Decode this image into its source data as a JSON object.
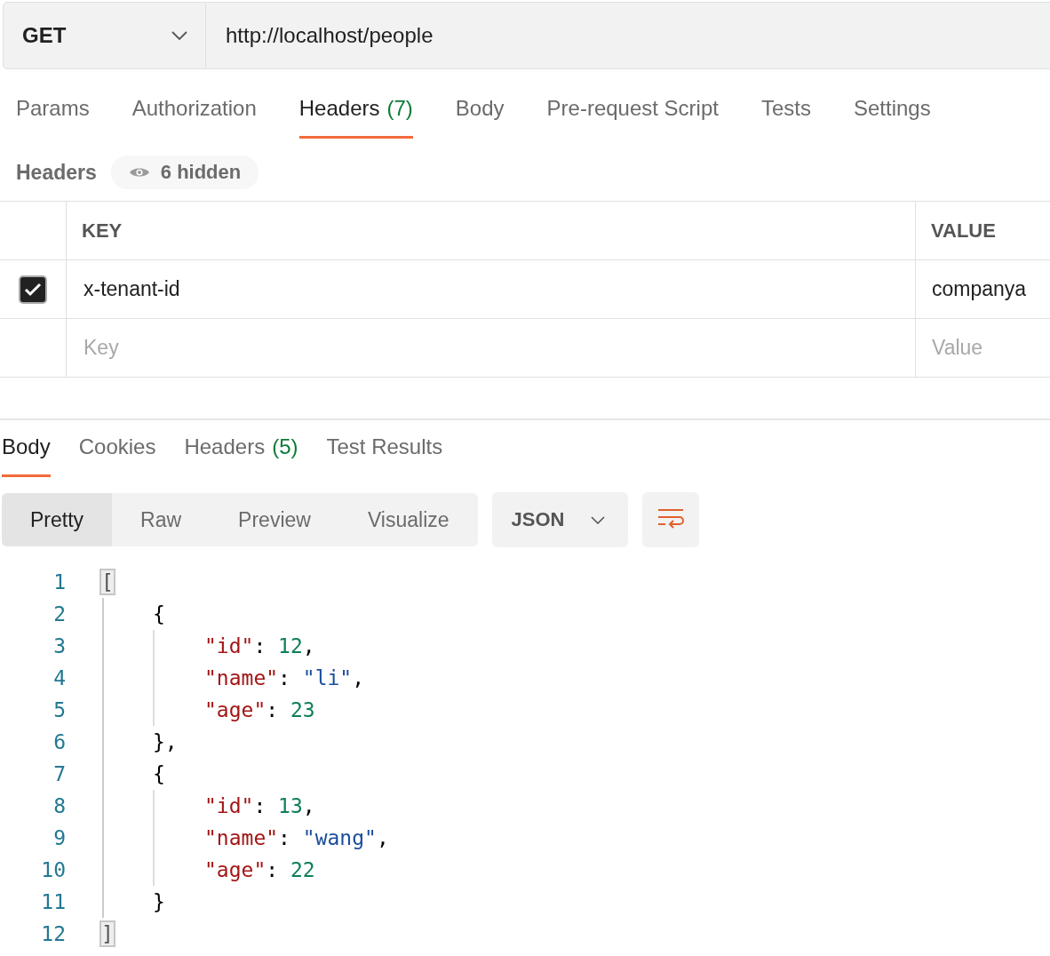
{
  "request": {
    "method": "GET",
    "url": "http://localhost/people"
  },
  "request_tabs": [
    {
      "label": "Params",
      "selected": false
    },
    {
      "label": "Authorization",
      "selected": false
    },
    {
      "label": "Headers",
      "count": "(7)",
      "selected": true
    },
    {
      "label": "Body",
      "selected": false
    },
    {
      "label": "Pre-request Script",
      "selected": false
    },
    {
      "label": "Tests",
      "selected": false
    },
    {
      "label": "Settings",
      "selected": false
    }
  ],
  "headers": {
    "title": "Headers",
    "hidden_badge": "6 hidden",
    "columns": [
      "KEY",
      "VALUE"
    ],
    "rows": [
      {
        "checked": true,
        "key": "x-tenant-id",
        "value": "companya"
      }
    ],
    "new_row": {
      "key_placeholder": "Key",
      "value_placeholder": "Value"
    }
  },
  "response_tabs": [
    {
      "label": "Body",
      "selected": true
    },
    {
      "label": "Cookies",
      "selected": false
    },
    {
      "label": "Headers",
      "count": "(5)",
      "selected": false
    },
    {
      "label": "Test Results",
      "selected": false
    }
  ],
  "view_modes": [
    {
      "label": "Pretty",
      "selected": true
    },
    {
      "label": "Raw",
      "selected": false
    },
    {
      "label": "Preview",
      "selected": false
    },
    {
      "label": "Visualize",
      "selected": false
    }
  ],
  "format": "JSON",
  "code": {
    "line_numbers": [
      "1",
      "2",
      "3",
      "4",
      "5",
      "6",
      "7",
      "8",
      "9",
      "10",
      "11",
      "12"
    ],
    "blocks": [
      {
        "open": [
          {
            "kind": "bracket_match",
            "text": "["
          }
        ],
        "close": [
          {
            "kind": "bracket_match",
            "text": "]"
          }
        ],
        "children": [
          {
            "open": [
              {
                "kind": "punct",
                "text": "{"
              }
            ],
            "close": [
              {
                "kind": "punct",
                "text": "},"
              }
            ],
            "children": [
              {
                "tokens": [
                  {
                    "kind": "key",
                    "text": "\"id\""
                  },
                  {
                    "kind": "punct",
                    "text": ": "
                  },
                  {
                    "kind": "number",
                    "text": "12"
                  },
                  {
                    "kind": "punct",
                    "text": ","
                  }
                ]
              },
              {
                "tokens": [
                  {
                    "kind": "key",
                    "text": "\"name\""
                  },
                  {
                    "kind": "punct",
                    "text": ": "
                  },
                  {
                    "kind": "string",
                    "text": "\"li\""
                  },
                  {
                    "kind": "punct",
                    "text": ","
                  }
                ]
              },
              {
                "tokens": [
                  {
                    "kind": "key",
                    "text": "\"age\""
                  },
                  {
                    "kind": "punct",
                    "text": ": "
                  },
                  {
                    "kind": "number",
                    "text": "23"
                  }
                ]
              }
            ]
          },
          {
            "open": [
              {
                "kind": "punct",
                "text": "{"
              }
            ],
            "close": [
              {
                "kind": "punct",
                "text": "}"
              }
            ],
            "children": [
              {
                "tokens": [
                  {
                    "kind": "key",
                    "text": "\"id\""
                  },
                  {
                    "kind": "punct",
                    "text": ": "
                  },
                  {
                    "kind": "number",
                    "text": "13"
                  },
                  {
                    "kind": "punct",
                    "text": ","
                  }
                ]
              },
              {
                "tokens": [
                  {
                    "kind": "key",
                    "text": "\"name\""
                  },
                  {
                    "kind": "punct",
                    "text": ": "
                  },
                  {
                    "kind": "string",
                    "text": "\"wang\""
                  },
                  {
                    "kind": "punct",
                    "text": ","
                  }
                ]
              },
              {
                "tokens": [
                  {
                    "kind": "key",
                    "text": "\"age\""
                  },
                  {
                    "kind": "punct",
                    "text": ": "
                  },
                  {
                    "kind": "number",
                    "text": "22"
                  }
                ]
              }
            ]
          }
        ]
      }
    ]
  }
}
